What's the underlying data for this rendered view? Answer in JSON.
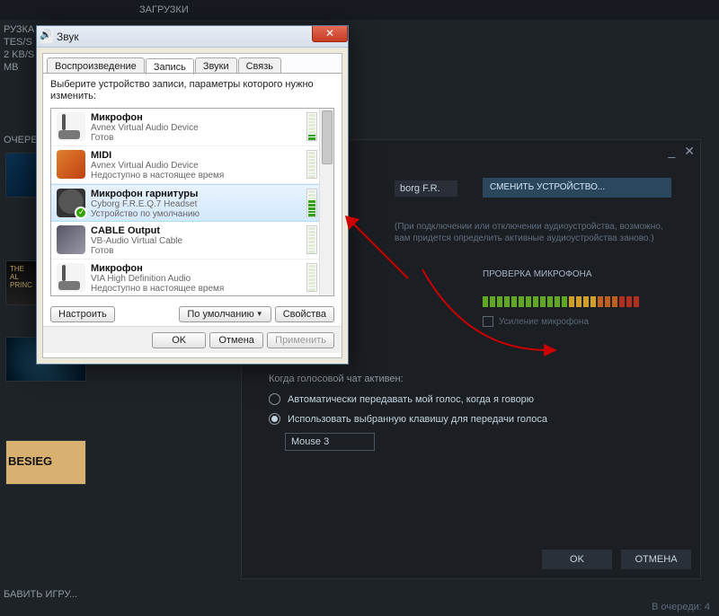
{
  "topTab": "ЗАГРУЗКИ",
  "bgLeft": {
    "l1": "РУЗКА",
    "l2": "TES/S",
    "l3": "2 KB/S",
    "l4": "MB"
  },
  "queueLabel": "ОЧЕРЕДИ",
  "thumbTitles": {
    "t2a": "THE",
    "t2b": "AL",
    "t2c": "PRINC",
    "t4": "BESIEG"
  },
  "addGame": "БАВИТЬ ИГРУ...",
  "queueCount": "В очереди: 4",
  "voice": {
    "device": "borg F.R.",
    "changeDevice": "СМЕНИТЬ УСТРОЙСТВО...",
    "hint": "(При подключении или отключении аудиоустройства, возможно, вам придется определить активные аудиоустройства заново.)",
    "micTest": "ПРОВЕРКА МИКРОФОНА",
    "amp": "Усиление микрофона",
    "activeLabel": "Когда голосовой чат активен:",
    "radioAuto": "Автоматически передавать мой голос, когда я говорю",
    "radioKey": "Использовать выбранную клавишу для передачи голоса",
    "keyName": "Mouse 3",
    "ok": "OK",
    "cancel": "ОТМЕНА"
  },
  "win": {
    "title": "Звук",
    "tabs": {
      "play": "Воспроизведение",
      "rec": "Запись",
      "sounds": "Звуки",
      "comm": "Связь"
    },
    "instr1": "Выберите устройство записи, параметры которого нужно",
    "instr2": "изменить:",
    "devices": [
      {
        "name": "Микрофон",
        "sub1": "Avnex Virtual Audio Device",
        "sub2": "Готов",
        "icon": "mic",
        "lvl": [
          1,
          1,
          0,
          0,
          0,
          0,
          0,
          0
        ]
      },
      {
        "name": "MIDI",
        "sub1": "Avnex Virtual Audio Device",
        "sub2": "Недоступно в настоящее время",
        "icon": "midi",
        "lvl": [
          0,
          0,
          0,
          0,
          0,
          0,
          0,
          0
        ]
      },
      {
        "name": "Микрофон гарнитуры",
        "sub1": "Cyborg F.R.E.Q.7 Headset",
        "sub2": "Устройство по умолчанию",
        "icon": "headset",
        "selected": true,
        "lvl": [
          1,
          1,
          1,
          1,
          1,
          0,
          0,
          0
        ]
      },
      {
        "name": "CABLE Output",
        "sub1": "VB-Audio Virtual Cable",
        "sub2": "Готов",
        "icon": "cable",
        "lvl": [
          0,
          0,
          0,
          0,
          0,
          0,
          0,
          0
        ]
      },
      {
        "name": "Микрофон",
        "sub1": "VIA High Definition Audio",
        "sub2": "Недоступно в настоящее время",
        "icon": "mic",
        "lvl": [
          0,
          0,
          0,
          0,
          0,
          0,
          0,
          0
        ]
      }
    ],
    "configure": "Настроить",
    "default": "По умолчанию",
    "properties": "Свойства",
    "ok": "OK",
    "cancel": "Отмена",
    "apply": "Применить"
  }
}
